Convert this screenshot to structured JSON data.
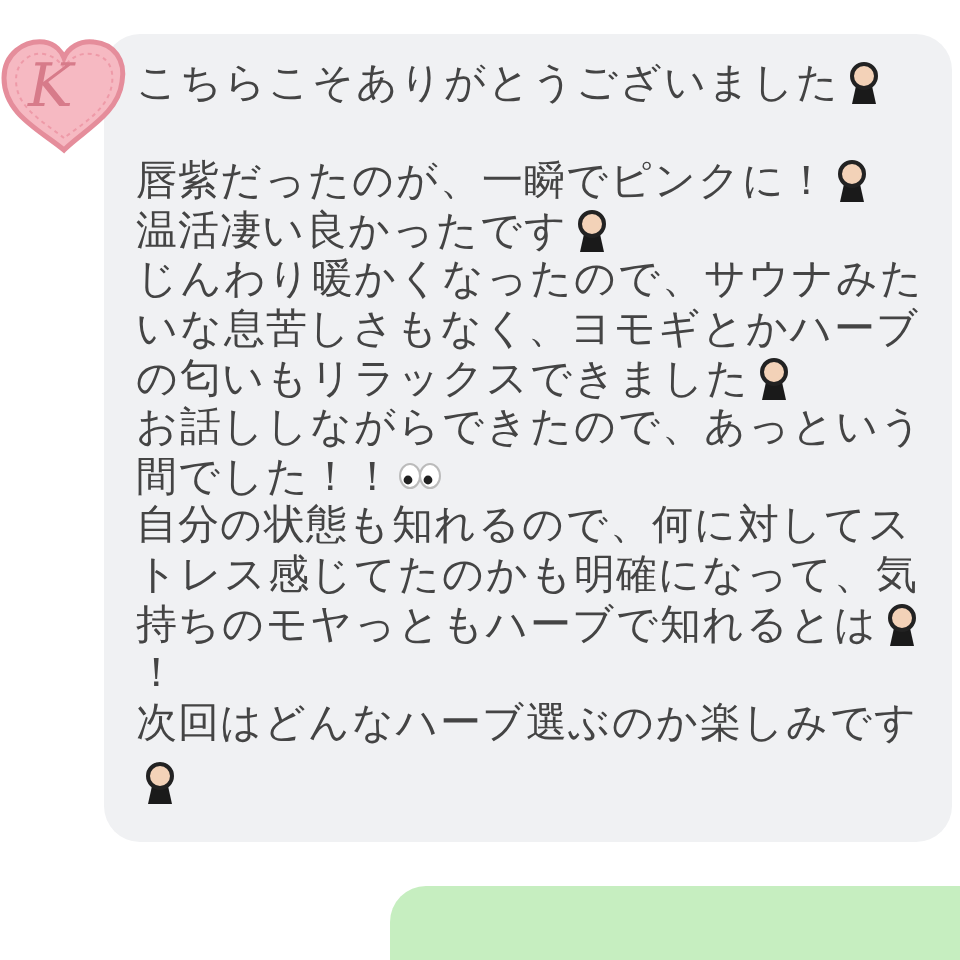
{
  "avatar": {
    "letter": "K"
  },
  "message": {
    "paragraphs": [
      [
        [
          {
            "kind": "text",
            "text": "こちらこそありがとうございました"
          },
          {
            "kind": "figure"
          }
        ]
      ],
      [
        [
          {
            "kind": "text",
            "text": "唇紫だったのが、一瞬でピンクに！"
          },
          {
            "kind": "figure"
          }
        ],
        [
          {
            "kind": "text",
            "text": "温活凄い良かったです"
          },
          {
            "kind": "figure"
          }
        ],
        [
          {
            "kind": "text",
            "text": "じんわり暖かくなったので、サウナみた"
          }
        ],
        [
          {
            "kind": "text",
            "text": "いな息苦しさもなく、ヨモギとかハーブ"
          }
        ],
        [
          {
            "kind": "text",
            "text": "の匂いもリラックスできました"
          },
          {
            "kind": "figure"
          }
        ],
        [
          {
            "kind": "text",
            "text": "お話ししながらできたので、あっという"
          }
        ],
        [
          {
            "kind": "text",
            "text": "間でした！！"
          },
          {
            "kind": "eyes"
          }
        ],
        [
          {
            "kind": "text",
            "text": "自分の状態も知れるので、何に対してス"
          }
        ],
        [
          {
            "kind": "text",
            "text": "トレス感じてたのかも明確になって、気"
          }
        ],
        [
          {
            "kind": "text",
            "text": "持ちのモヤっともハーブで知れるとは"
          },
          {
            "kind": "figure"
          }
        ],
        [
          {
            "kind": "text",
            "text": "！"
          }
        ],
        [
          {
            "kind": "text",
            "text": "次回はどんなハーブ選ぶのか楽しみです"
          }
        ],
        [
          {
            "kind": "figure"
          }
        ]
      ]
    ]
  },
  "reply": {
    "kind": "outgoing"
  }
}
